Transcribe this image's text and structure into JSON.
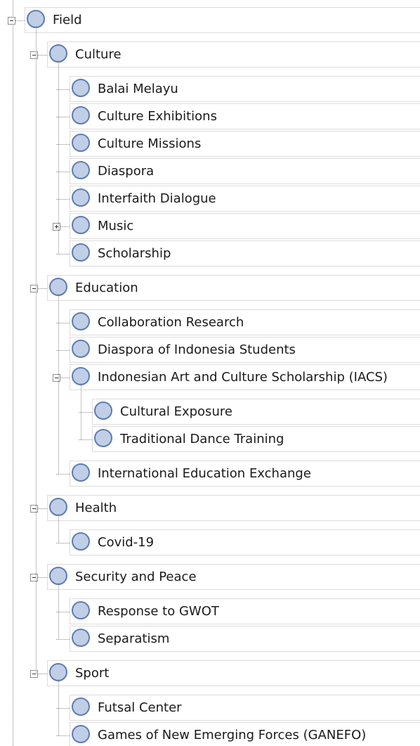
{
  "tree": {
    "label": "Field",
    "expanded": true,
    "children": [
      {
        "label": "Culture",
        "expanded": true,
        "children": [
          {
            "label": "Balai Melayu"
          },
          {
            "label": "Culture Exhibitions"
          },
          {
            "label": "Culture Missions"
          },
          {
            "label": "Diaspora"
          },
          {
            "label": "Interfaith Dialogue"
          },
          {
            "label": "Music",
            "expanded": false,
            "collapsed_has_children": true
          },
          {
            "label": "Scholarship"
          }
        ]
      },
      {
        "label": "Education",
        "expanded": true,
        "children": [
          {
            "label": "Collaboration Research"
          },
          {
            "label": "Diaspora of Indonesia Students"
          },
          {
            "label": "Indonesian Art and Culture Scholarship (IACS)",
            "expanded": true,
            "children": [
              {
                "label": "Cultural Exposure"
              },
              {
                "label": "Traditional Dance Training"
              }
            ]
          },
          {
            "label": "International Education Exchange"
          }
        ]
      },
      {
        "label": "Health",
        "expanded": true,
        "children": [
          {
            "label": "Covid-19"
          }
        ]
      },
      {
        "label": "Security and Peace",
        "expanded": true,
        "children": [
          {
            "label": "Response to GWOT"
          },
          {
            "label": "Separatism"
          }
        ]
      },
      {
        "label": "Sport",
        "expanded": true,
        "children": [
          {
            "label": "Futsal Center"
          },
          {
            "label": "Games of New Emerging Forces (GANEFO)"
          }
        ]
      }
    ]
  },
  "colors": {
    "node_fill": "#c0cfe6",
    "node_border": "#5d7cb1",
    "row_border": "#dcdcdc",
    "connector": "#8a8a8a"
  }
}
